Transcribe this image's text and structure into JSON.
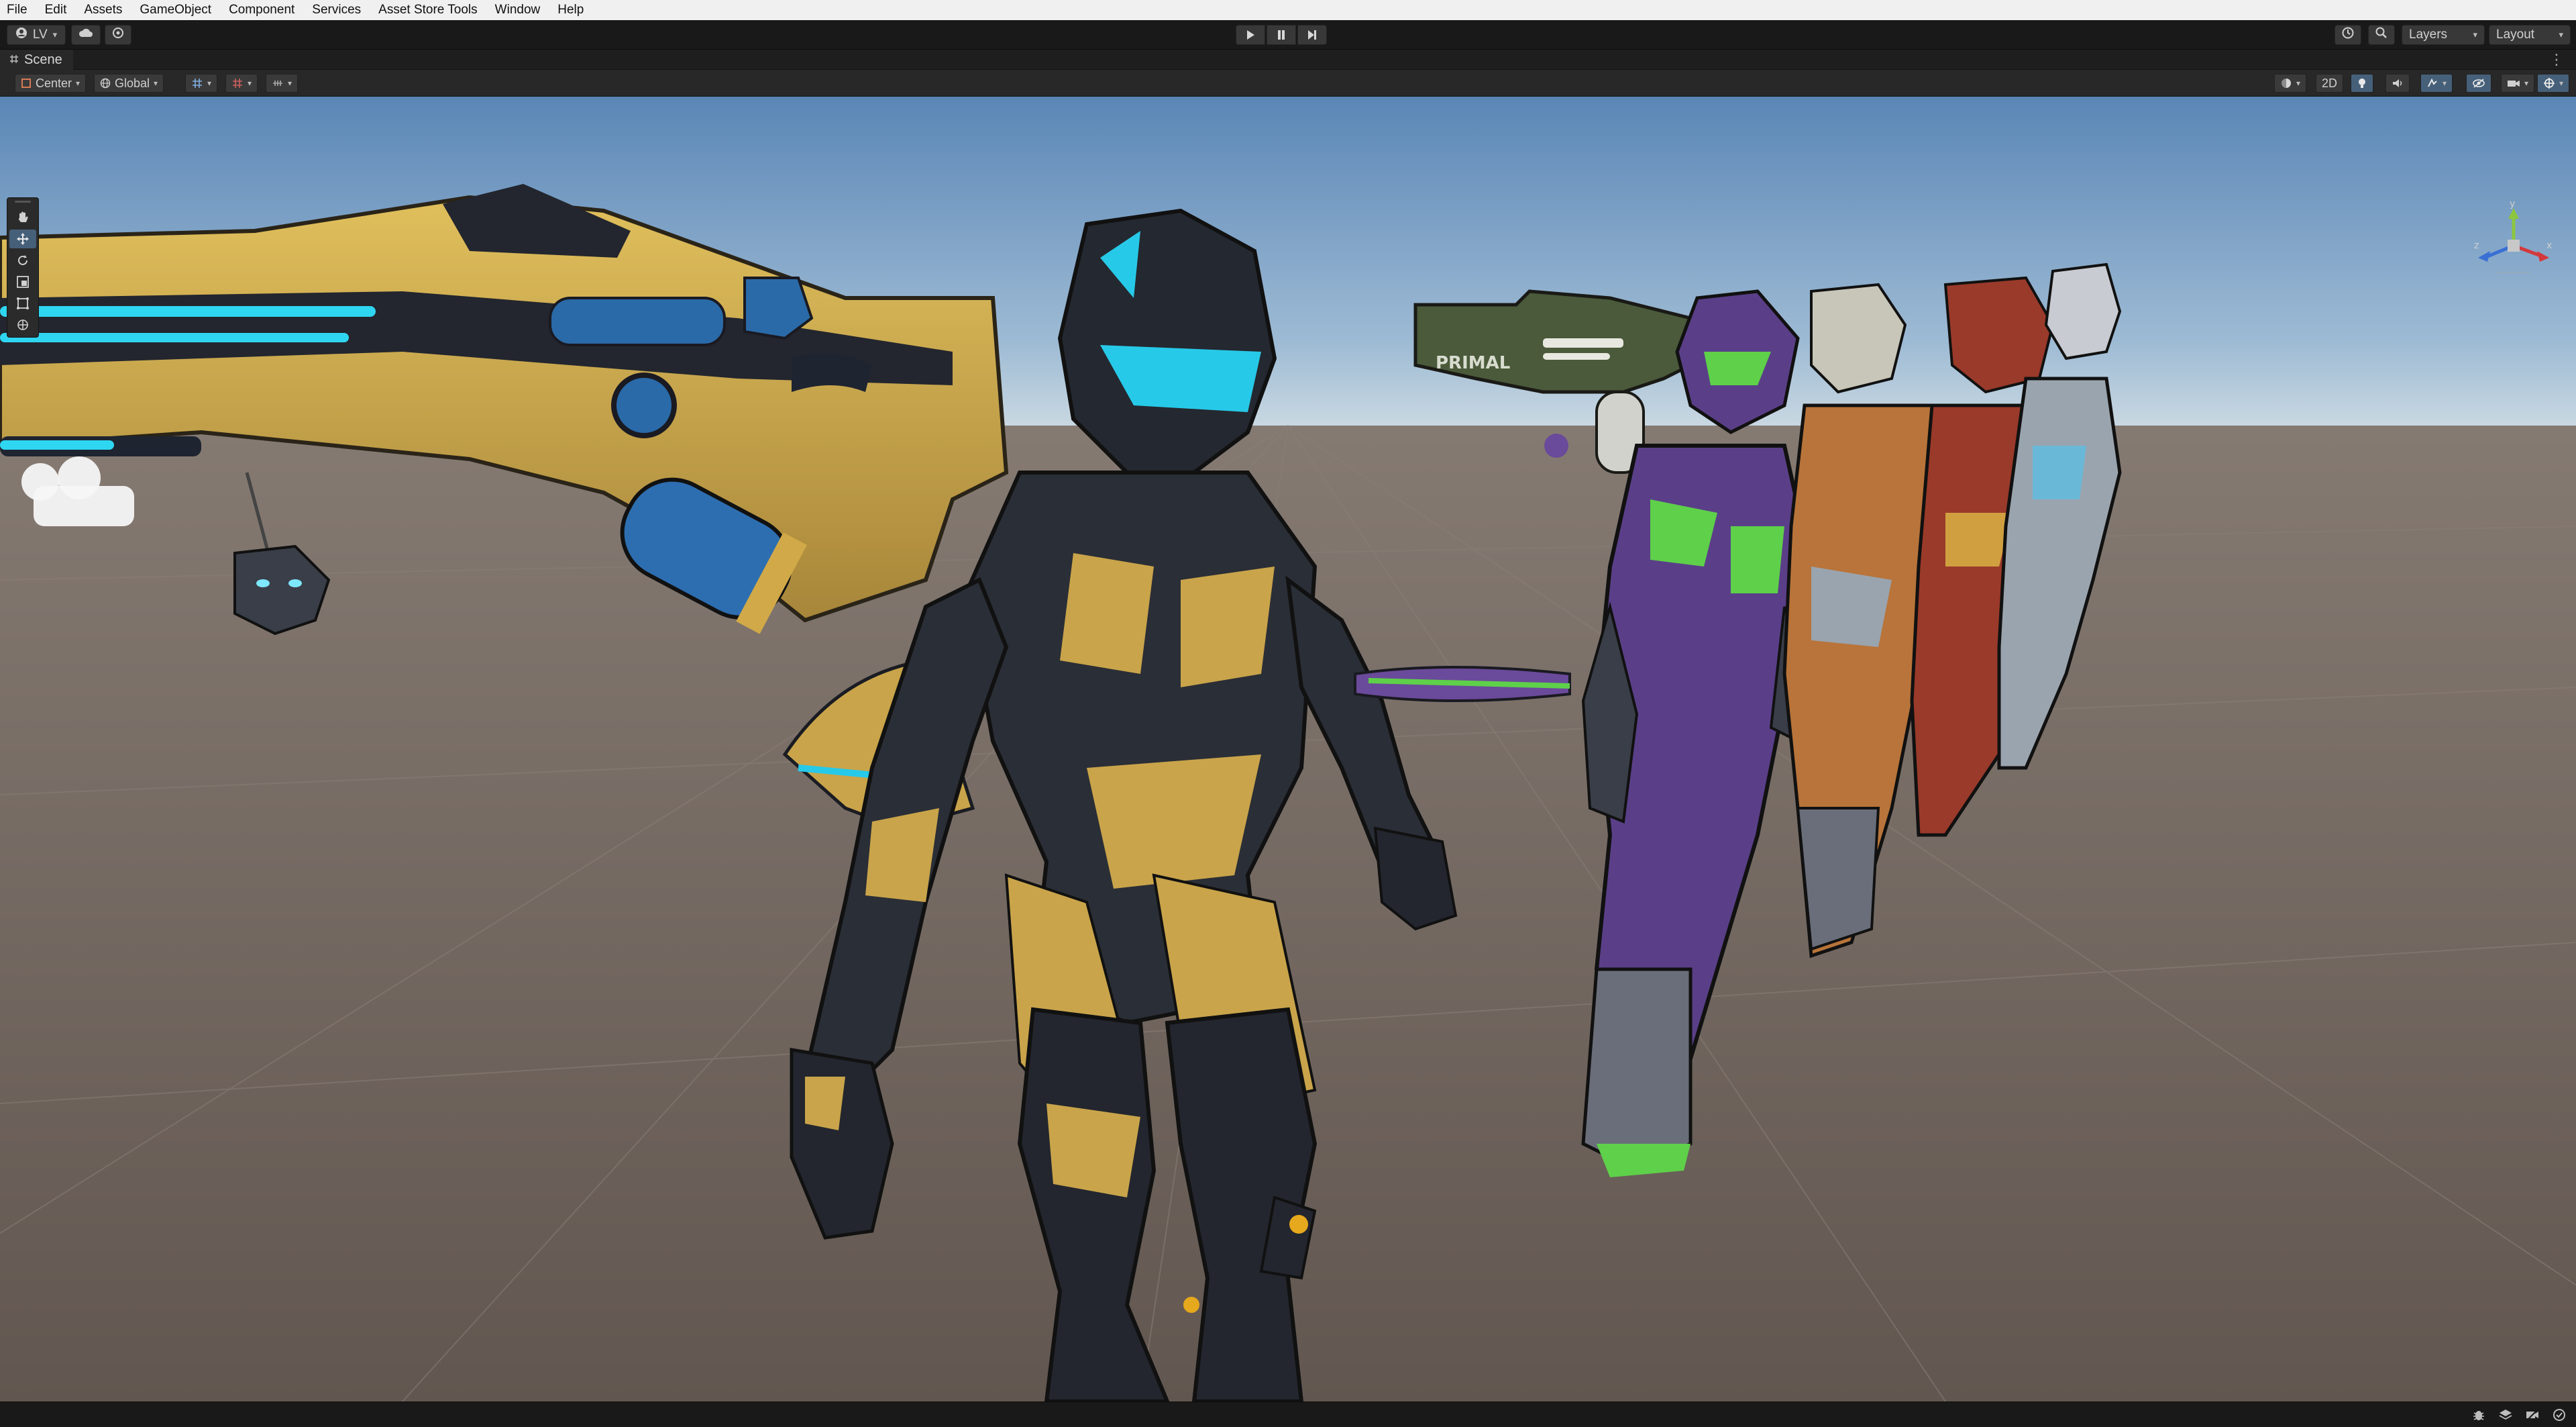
{
  "menu": {
    "items": [
      "File",
      "Edit",
      "Assets",
      "GameObject",
      "Component",
      "Services",
      "Asset Store Tools",
      "Window",
      "Help"
    ]
  },
  "toolbar": {
    "account_label": "LV",
    "layers_label": "Layers",
    "layout_label": "Layout",
    "icons": {
      "account": "account-icon",
      "cloud": "cloud-icon",
      "collab": "collab-icon",
      "play": "play-icon",
      "pause": "pause-icon",
      "step": "step-icon",
      "history": "history-icon",
      "search": "search-icon"
    }
  },
  "scene_tab": {
    "label": "Scene",
    "icon": "scene-grid-icon"
  },
  "scene_toolbar": {
    "pivot_label": "Center",
    "space_label": "Global",
    "mode_2d_label": "2D",
    "icons": [
      "grid-snap-icon",
      "snap-increment-icon",
      "shading-icon",
      "lighting-icon",
      "audio-icon",
      "fx-icon",
      "hidden-objects-icon",
      "camera-icon",
      "gizmos-icon"
    ]
  },
  "tools": [
    "hand-tool-icon",
    "move-tool-icon",
    "rotate-tool-icon",
    "scale-tool-icon",
    "rect-tool-icon",
    "transform-tool-icon"
  ],
  "gizmo": {
    "y_label": "y",
    "x_label": "x",
    "z_label": "z",
    "colors": {
      "x": "#d3393c",
      "y": "#8cc63f",
      "z": "#3a6fd4",
      "neutral": "#c8c8c8"
    }
  },
  "scene": {
    "sky_top": "#5c88b8",
    "sky_horizon": "#c7d8e4",
    "ground": "#6d615a",
    "gun_text": "PRIMAL",
    "palette": {
      "gold": "#c9a44a",
      "dark_armor": "#2a2e36",
      "cyan_glow": "#27c9e8",
      "purple": "#6a4a9a",
      "green_glow": "#5ed04a",
      "orange": "#b8743a",
      "red": "#9a3a2a",
      "silver": "#9aa4ae",
      "olive_gun": "#4a5a3a"
    }
  },
  "status": {
    "icons": [
      "bug-icon",
      "layers-status-icon",
      "camera-status-icon",
      "settings-status-icon"
    ]
  }
}
